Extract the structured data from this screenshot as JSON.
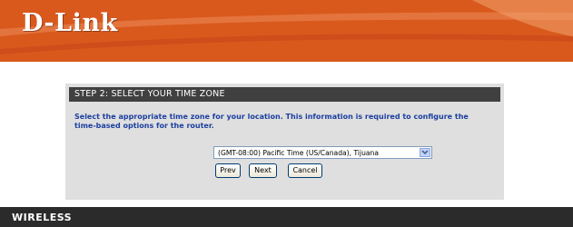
{
  "header": {
    "logo_text": "D-Link",
    "background": "#d9591d"
  },
  "step": {
    "title": "STEP 2: SELECT YOUR TIME ZONE",
    "description": "Select the appropriate time zone for your location. This information is required to configure the time-based options for the router."
  },
  "timezone": {
    "selected": "(GMT-08:00) Pacific Time (US/Canada), Tijuana"
  },
  "actions": {
    "prev_label": "Prev",
    "next_label": "Next",
    "cancel_label": "Cancel"
  },
  "footer": {
    "label": "WIRELESS"
  },
  "icons": {
    "dropdown": "chevron-down-icon"
  }
}
